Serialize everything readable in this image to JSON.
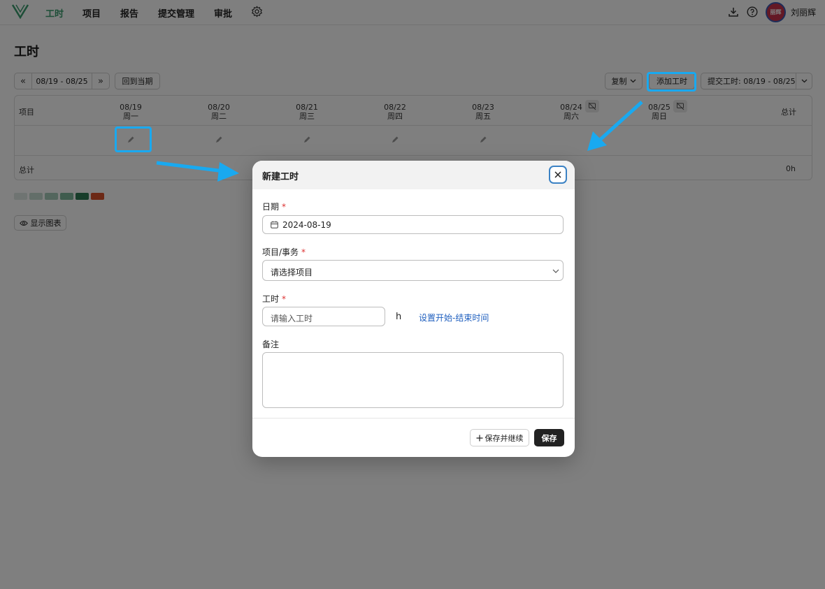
{
  "nav": {
    "items": [
      "工时",
      "项目",
      "报告",
      "提交管理",
      "审批"
    ],
    "active_index": 0,
    "username": "刘丽辉",
    "avatar_text": "丽辉",
    "icons": [
      "download-icon",
      "help-icon",
      "gear-icon"
    ]
  },
  "page": {
    "title": "工时",
    "week_range": "08/19 - 08/25",
    "back_to_current": "回到当期",
    "copy_label": "复制",
    "add_label": "添加工时",
    "submit_label": "提交工时: 08/19 - 08/25"
  },
  "grid": {
    "project_header": "项目",
    "total_header": "总计",
    "days": [
      {
        "date": "08/19",
        "weekday": "周一"
      },
      {
        "date": "08/20",
        "weekday": "周二"
      },
      {
        "date": "08/21",
        "weekday": "周三"
      },
      {
        "date": "08/22",
        "weekday": "周四"
      },
      {
        "date": "08/23",
        "weekday": "周五"
      },
      {
        "date": "08/24",
        "weekday": "周六"
      },
      {
        "date": "08/25",
        "weekday": "周日"
      }
    ],
    "total_row_label": "总计",
    "total_value": "0h"
  },
  "legend_colors": [
    "#dfe9e4",
    "#c6ddd2",
    "#a7cdbb",
    "#7fb89c",
    "#2f7a55",
    "#d9532c"
  ],
  "show_chart_label": "显示图表",
  "modal": {
    "title": "新建工时",
    "date_label": "日期",
    "date_value": "2024-08-19",
    "project_label": "项目/事务",
    "project_placeholder": "请选择项目",
    "hours_label": "工时",
    "hours_placeholder": "请输入工时",
    "hours_unit": "h",
    "set_time_link": "设置开始-结束时间",
    "note_label": "备注",
    "required_mark": "*",
    "save_continue_label": "保存并继续",
    "save_label": "保存"
  },
  "colors": {
    "accent_green": "#3a9d6f",
    "highlight_blue": "#19a9f0",
    "link_blue": "#1f5fbf"
  }
}
